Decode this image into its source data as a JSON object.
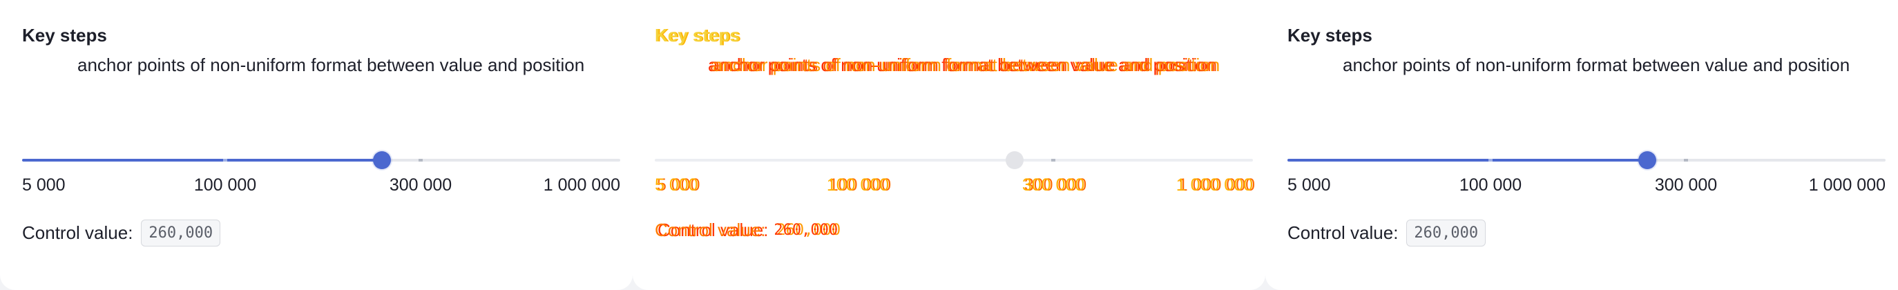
{
  "panels": [
    {
      "heading": "Key steps",
      "description": "anchor points of non-uniform format between value and position",
      "ticks": [
        "5 000",
        "100 000",
        "300 000",
        "1 000 000"
      ],
      "control_label": "Control value:",
      "control_value": "260,000",
      "slider_value": 260000
    },
    {
      "heading": "Key steps",
      "description": "anchor points of non-uniform format between value and position",
      "ticks": [
        "5 000",
        "100 000",
        "300 000",
        "1 000 000"
      ],
      "control_label": "Control value:",
      "control_value": "260,000",
      "slider_value": 260000
    },
    {
      "heading": "Key steps",
      "description": "anchor points of non-uniform format between value and position",
      "ticks": [
        "5 000",
        "100 000",
        "300 000",
        "1 000 000"
      ],
      "control_label": "Control value:",
      "control_value": "260,000",
      "slider_value": 260000
    }
  ],
  "colors": {
    "accent": "#4b68cf",
    "track": "#e5e7ec",
    "text": "#1d1f2a"
  }
}
